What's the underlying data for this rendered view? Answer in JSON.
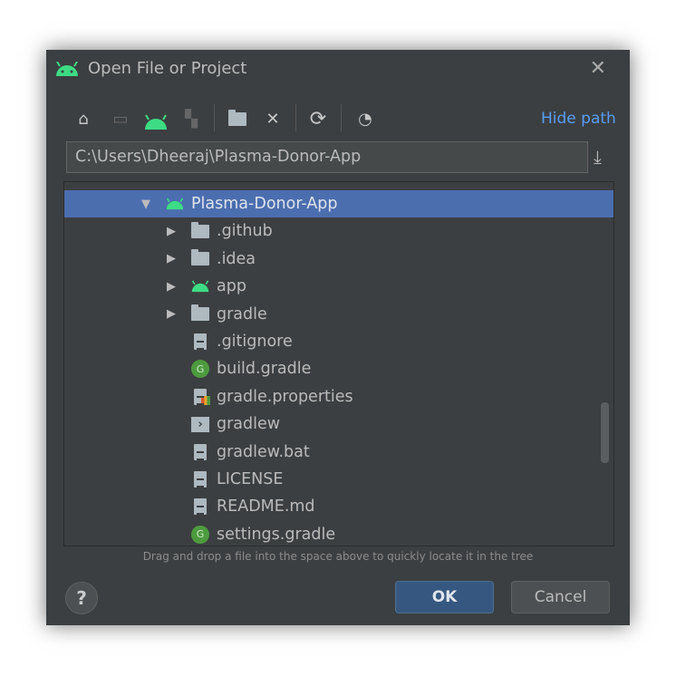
{
  "dialog": {
    "title": "Open File or Project",
    "close_icon": "close-icon"
  },
  "toolbar": {
    "hide_path": "Hide path",
    "icons": [
      "home-icon",
      "desktop-icon",
      "android-project-icon",
      "module-icon",
      "new-folder-icon",
      "delete-icon",
      "refresh-icon",
      "show-hidden-icon"
    ]
  },
  "path": {
    "value": "C:\\Users\\Dheeraj\\Plasma-Donor-App"
  },
  "tree": {
    "items": [
      {
        "label": "Plasma-Donor-App",
        "icon": "android",
        "expanded": true,
        "selected": true,
        "depth": 0
      },
      {
        "label": ".github",
        "icon": "folder",
        "expandable": true,
        "depth": 1
      },
      {
        "label": ".idea",
        "icon": "folder",
        "expandable": true,
        "depth": 1
      },
      {
        "label": "app",
        "icon": "android",
        "expandable": true,
        "depth": 1
      },
      {
        "label": "gradle",
        "icon": "folder",
        "expandable": true,
        "depth": 1
      },
      {
        "label": ".gitignore",
        "icon": "ignore-file",
        "depth": 1
      },
      {
        "label": "build.gradle",
        "icon": "gradle",
        "depth": 1
      },
      {
        "label": "gradle.properties",
        "icon": "properties",
        "depth": 1
      },
      {
        "label": "gradlew",
        "icon": "shell",
        "depth": 1
      },
      {
        "label": "gradlew.bat",
        "icon": "file",
        "depth": 1
      },
      {
        "label": "LICENSE",
        "icon": "file",
        "depth": 1
      },
      {
        "label": "README.md",
        "icon": "file",
        "depth": 1
      },
      {
        "label": "settings.gradle",
        "icon": "gradle",
        "depth": 1
      }
    ]
  },
  "hint": "Drag and drop a file into the space above to quickly locate it in the tree",
  "buttons": {
    "help": "?",
    "ok": "OK",
    "cancel": "Cancel"
  },
  "colors": {
    "accent": "#4b6eaf",
    "android": "#3ddc84",
    "link": "#589df6"
  }
}
